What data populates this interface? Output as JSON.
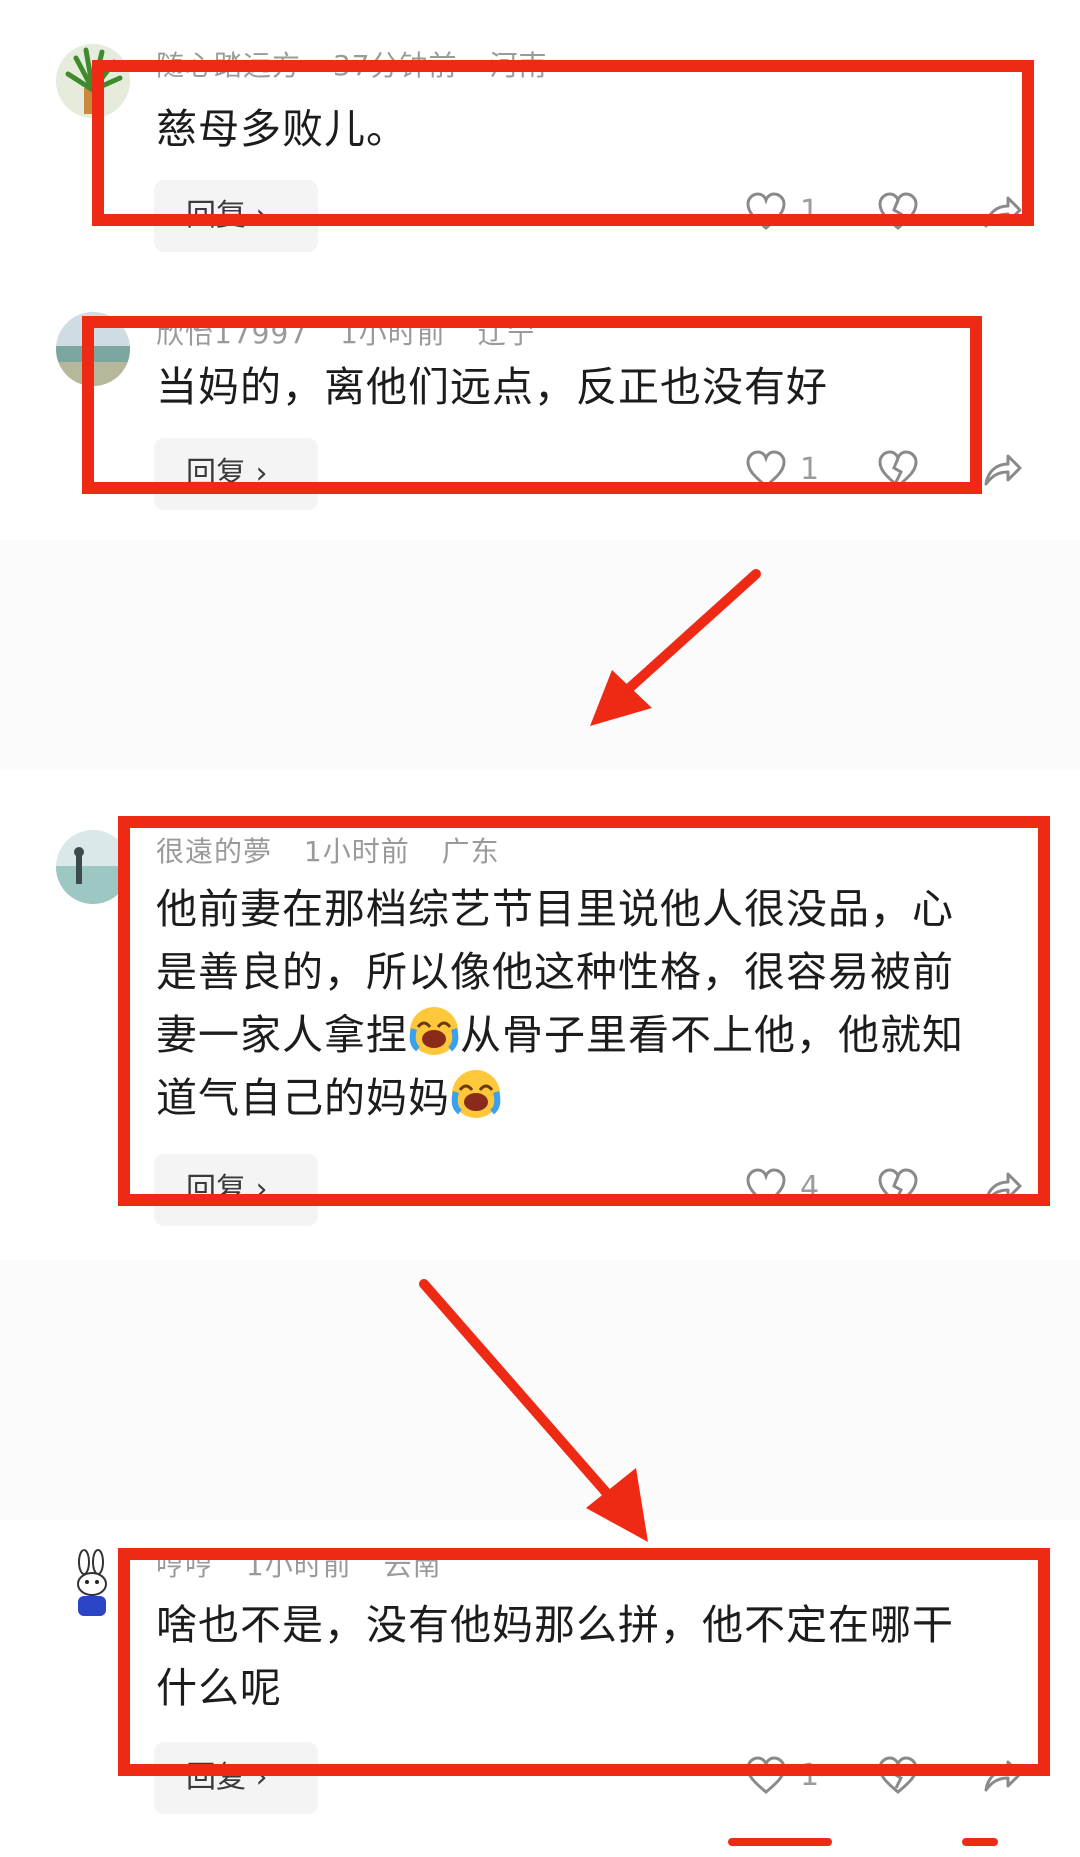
{
  "comments": [
    {
      "username": "随心踏远方",
      "time": "37分钟前",
      "location": "河南",
      "text": "慈母多败儿。",
      "reply_label": "回复 ›",
      "like_count": "1"
    },
    {
      "username": "欣怡17997",
      "time": "1小时前",
      "location": "辽宁",
      "text": "当妈的，离他们远点，反正也没有好",
      "reply_label": "回复 ›",
      "like_count": "1"
    },
    {
      "username": "很遠的夢",
      "time": "1小时前",
      "location": "广东",
      "lines": [
        "他前妻在那档综艺节目里说他人很没品，心",
        "是善良的，所以像他这种性格，很容易被前",
        "妻一家人拿捏",
        "从骨子里看不上他，他就知",
        "道气自己的妈妈"
      ],
      "reply_label": "回复 ›",
      "like_count": "4"
    },
    {
      "username": "哼哼",
      "time": "1小时前",
      "location": "云南",
      "lines": [
        "啥也不是，没有他妈那么拼，他不定在哪干",
        "什么呢"
      ],
      "reply_label": "回复 ›",
      "like_count": "1"
    }
  ],
  "icons": {
    "like": "heart-icon",
    "dislike": "broken-heart-icon",
    "share": "share-icon",
    "emoji": "laughing-crying-emoji"
  },
  "colors": {
    "highlight": "#ee2a15",
    "meta_text": "#9a9a9a",
    "body_text": "#1c1c1c"
  }
}
